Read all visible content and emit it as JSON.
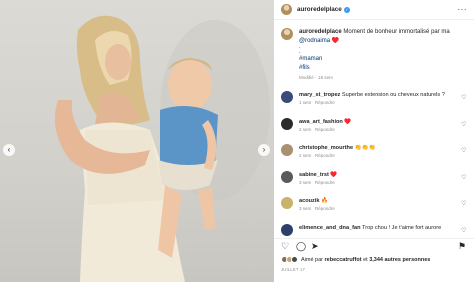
{
  "header": {
    "username": "auroredelplace",
    "verified_icon": "verified-badge-icon",
    "more_icon": "more-options-icon",
    "more_label": "···"
  },
  "caption": {
    "username": "auroredelplace",
    "text": "Moment de bonheur immortalisé par ma",
    "mention": "@rodnaima",
    "emoji": "♥️",
    "sep1": ".",
    "sep2": ".",
    "hashtag1": "#maman",
    "hashtag2": "#fils",
    "meta": "Modifié · 18 sem"
  },
  "comments": [
    {
      "username": "mary_st_tropez",
      "text": "Superbe extension ou cheveux naturels ?",
      "time": "1 sem",
      "reply": "Répondre",
      "avatar_color": "#3a4a7a"
    },
    {
      "username": "awa_art_fashion",
      "text": "♥️",
      "time": "2 sem",
      "reply": "Répondre",
      "avatar_color": "#2b2b2b"
    },
    {
      "username": "christophe_mourthe",
      "text": "👏👏👏",
      "time": "2 sem",
      "reply": "Répondre",
      "avatar_color": "#a89070"
    },
    {
      "username": "sabine_trst",
      "text": "♥️",
      "time": "3 sem",
      "reply": "Répondre",
      "avatar_color": "#5a5a5a"
    },
    {
      "username": "acouzik",
      "text": "🔥",
      "time": "3 sem",
      "reply": "Répondre",
      "avatar_color": "#c9b26a"
    },
    {
      "username": "elimence_and_dna_fan",
      "text": "Trop chou ! Je t'aime fort aurore",
      "time": "",
      "reply": "",
      "avatar_color": "#2d3f6b"
    }
  ],
  "actions": {
    "like_icon": "heart-icon",
    "comment_icon": "comment-icon",
    "share_icon": "share-icon",
    "save_icon": "bookmark-icon"
  },
  "likes": {
    "prefix": "Aimé par",
    "user": "rebeccatruffot",
    "middle": "et",
    "count": "3,344 autres personnes"
  },
  "date": "JUILLET 17",
  "photo": {
    "prev_icon": "chevron-left-icon",
    "next_icon": "chevron-right-icon",
    "prev_label": "‹",
    "next_label": "›"
  }
}
